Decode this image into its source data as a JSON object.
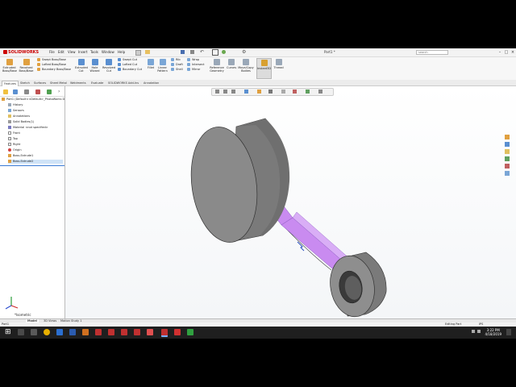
{
  "app": {
    "brand": "SOLIDWORKS",
    "doc_title": "Part1 *"
  },
  "menu": [
    "File",
    "Edit",
    "View",
    "Insert",
    "Tools",
    "Window",
    "Help"
  ],
  "search": {
    "placeholder": "search"
  },
  "ribbon": {
    "big": [
      {
        "label": "Extruded\nBoss/Base",
        "color": "#e0a040"
      },
      {
        "label": "Revolved\nBoss/Base",
        "color": "#e0a040"
      },
      {
        "label": "Extruded\nCut",
        "color": "#5a8fd0"
      },
      {
        "label": "Hole\nWizard",
        "color": "#5a8fd0"
      },
      {
        "label": "Revolved\nCut",
        "color": "#5a8fd0"
      },
      {
        "label": "Fillet",
        "color": "#7aa6d6"
      },
      {
        "label": "Linear\nPattern",
        "color": "#7aa6d6"
      },
      {
        "label": "Reference\nGeometry",
        "color": "#9aa8b8"
      },
      {
        "label": "Curves",
        "color": "#9aa8b8"
      },
      {
        "label": "Move/Copy\nBodies",
        "color": "#9aa8b8"
      },
      {
        "label": "Instant3D",
        "color": "#d8a030"
      },
      {
        "label": "Thread",
        "color": "#9aa8b8"
      }
    ],
    "small_col1": [
      "Swept Boss/Base",
      "Lofted Boss/Base",
      "Boundary Boss/Base"
    ],
    "small_col2": [
      "Swept Cut",
      "Lofted Cut",
      "Boundary Cut"
    ],
    "small_col3": [
      "Rib",
      "Draft",
      "Shell"
    ],
    "small_col4": [
      "Wrap",
      "Intersect",
      "Mirror"
    ]
  },
  "tabs": [
    "Features",
    "Sketch",
    "Surfaces",
    "Sheet Metal",
    "Weldments",
    "Evaluate",
    "SOLIDWORKS Add-Ins",
    "Annotation"
  ],
  "tree": {
    "root": "Part1 (Default<<Default>_PhotoWorks D",
    "nodes": [
      "History",
      "Sensors",
      "Annotations",
      "Solid Bodies(1)",
      "Material <not specified>",
      "Front",
      "Top",
      "Right",
      "Origin",
      "Boss-Extrude1",
      "Boss-Extrude2"
    ]
  },
  "view": {
    "label": "*Isometric"
  },
  "bottom_tabs": [
    "Model",
    "3D Views",
    "Motion Study 1"
  ],
  "status": {
    "left": "Part1",
    "mode": "Editing Part",
    "units": "IPS"
  },
  "clock": {
    "time": "3:22 PM",
    "date": "4/18/2019"
  },
  "colors": {
    "accent": "#c00000",
    "rod": "#c98bf0",
    "solid": "#9a9a9a"
  }
}
